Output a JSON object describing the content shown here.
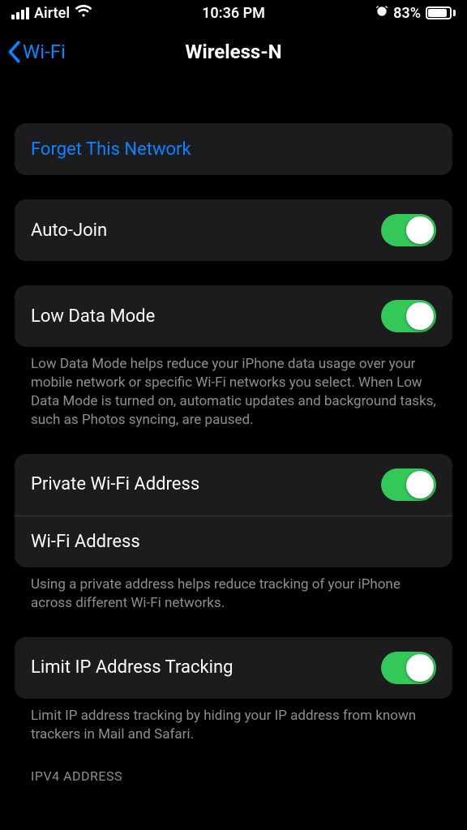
{
  "status": {
    "carrier": "Airtel",
    "time": "10:36 PM",
    "battery_pct": "83%"
  },
  "nav": {
    "back_label": "Wi-Fi",
    "title": "Wireless-N"
  },
  "forget": {
    "label": "Forget This Network"
  },
  "auto_join": {
    "label": "Auto-Join",
    "on": true
  },
  "low_data": {
    "label": "Low Data Mode",
    "on": true,
    "footer": "Low Data Mode helps reduce your iPhone data usage over your mobile network or specific Wi-Fi networks you select. When Low Data Mode is turned on, automatic updates and background tasks, such as Photos syncing, are paused."
  },
  "private_addr": {
    "label": "Private Wi-Fi Address",
    "on": true,
    "wifi_addr_label": "Wi-Fi Address",
    "footer": "Using a private address helps reduce tracking of your iPhone across different Wi-Fi networks."
  },
  "limit_tracking": {
    "label": "Limit IP Address Tracking",
    "on": true,
    "footer": "Limit IP address tracking by hiding your IP address from known trackers in Mail and Safari."
  },
  "ipv4_header": "IPV4 ADDRESS"
}
